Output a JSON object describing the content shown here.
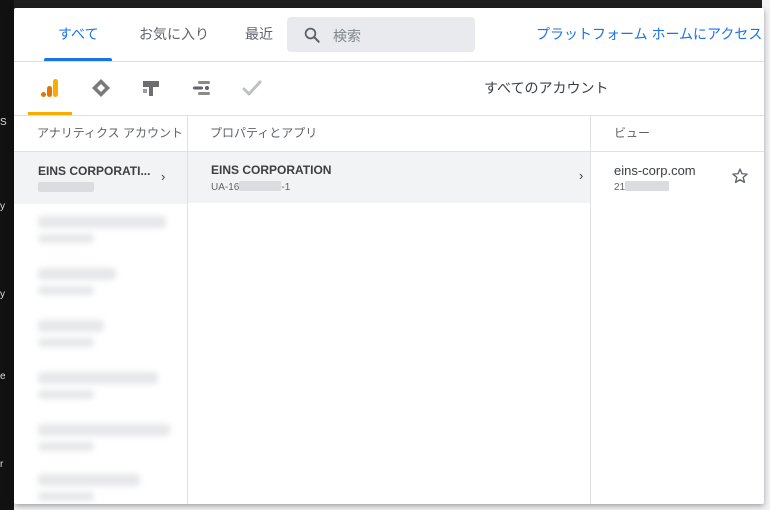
{
  "background": {
    "left_fragments": [
      "S",
      "y",
      "y",
      "e",
      "r"
    ]
  },
  "tabs": [
    {
      "label": "すべて",
      "active": true
    },
    {
      "label": "お気に入り",
      "active": false
    },
    {
      "label": "最近",
      "active": false
    }
  ],
  "search": {
    "placeholder": "検索"
  },
  "platform_link": "プラットフォーム ホームにアクセス",
  "products": [
    {
      "name": "analytics-icon",
      "active": true
    },
    {
      "name": "tag-manager-icon",
      "active": false
    },
    {
      "name": "optimize-icon",
      "active": false
    },
    {
      "name": "data-studio-icon",
      "active": false
    },
    {
      "name": "surveys-icon",
      "active": false
    }
  ],
  "all_accounts_label": "すべてのアカウント",
  "columns": {
    "accounts": "アナリティクス アカウント",
    "properties": "プロパティとアプリ",
    "views": "ビュー"
  },
  "accounts": [
    {
      "name": "EINS CORPORATI...",
      "selected": true
    }
  ],
  "property": {
    "name": "EINS CORPORATION",
    "id_prefix": "UA-16",
    "id_suffix": "-1"
  },
  "view": {
    "name": "eins-corp.com",
    "id_prefix": "21"
  },
  "colors": {
    "accent": "#1a73e8",
    "analytics": "#f9ab00",
    "selected_bg": "#f1f3f4"
  }
}
